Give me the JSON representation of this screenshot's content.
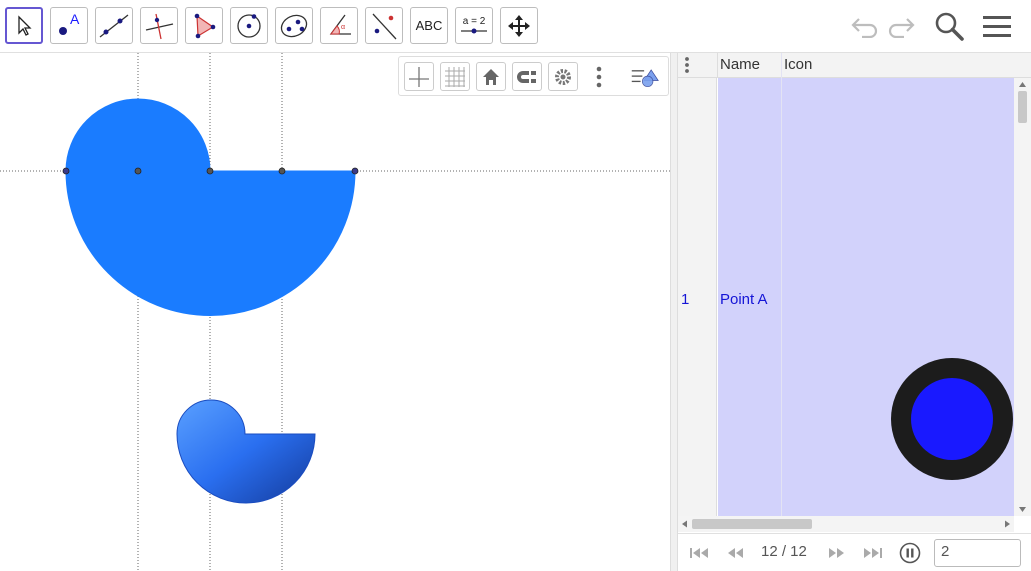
{
  "toolbar": {
    "tools": [
      {
        "name": "move-tool-icon",
        "label": ""
      },
      {
        "name": "point-tool-icon",
        "label": "A"
      },
      {
        "name": "line-tool-icon",
        "label": ""
      },
      {
        "name": "perpendicular-line-tool-icon",
        "label": ""
      },
      {
        "name": "polygon-tool-icon",
        "label": ""
      },
      {
        "name": "circle-tool-icon",
        "label": ""
      },
      {
        "name": "ellipse-tool-icon",
        "label": ""
      },
      {
        "name": "angle-tool-icon",
        "label": ""
      },
      {
        "name": "reflect-tool-icon",
        "label": ""
      },
      {
        "name": "text-tool-icon",
        "label": "ABC"
      },
      {
        "name": "slider-tool-icon",
        "label": "a = 2"
      },
      {
        "name": "move-graphics-view-icon",
        "label": ""
      }
    ],
    "undo_icon": "undo-icon",
    "redo_icon": "redo-icon",
    "search_icon": "search-icon",
    "menu_icon": "menu-icon"
  },
  "style_bar": {
    "buttons": [
      "axes-icon",
      "grid-icon",
      "home-icon",
      "point-capturing-icon",
      "settings-icon",
      "more-vertical-icon",
      "toggle-style-bar-icon"
    ]
  },
  "colors": {
    "shape_fill": "#1a7cff",
    "row_bg": "#d2d2fb",
    "active_tool_border": "#6557d2",
    "point_label": "#1515d6",
    "icon_ring": "#1c1c1c",
    "icon_dot": "#1919ff"
  },
  "construction_protocol": {
    "headers": {
      "name": "Name",
      "icon": "Icon"
    },
    "rows": [
      {
        "index": "1",
        "name": "Point A",
        "icon": "point-icon"
      }
    ]
  },
  "navigation": {
    "step_text": "12 / 12",
    "speed_value": "2",
    "buttons": [
      "first-step-icon",
      "previous-step-icon",
      "next-step-icon",
      "last-step-icon",
      "pause-icon"
    ]
  }
}
